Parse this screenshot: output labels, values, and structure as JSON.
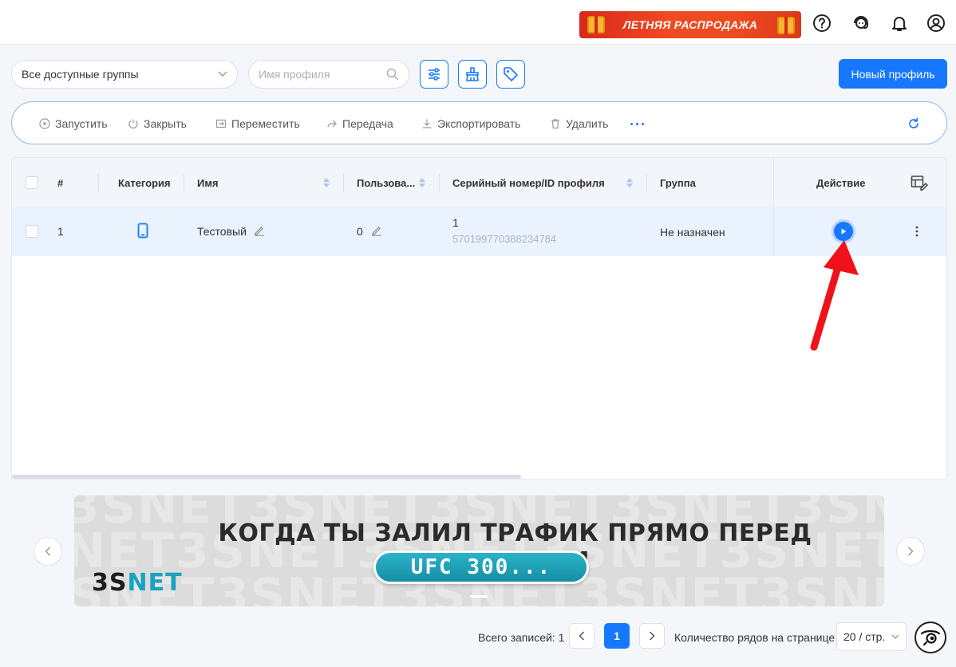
{
  "header": {
    "promo_label": "ЛЕТНЯЯ РАСПРОДАЖА",
    "icons": [
      "help-icon",
      "support-agent-icon",
      "bell-icon",
      "user-account-icon"
    ]
  },
  "filters": {
    "group_select_value": "Все доступные группы",
    "search_placeholder": "Имя профиля",
    "tool_buttons": [
      "filter-sliders-icon",
      "cleanup-broom-icon",
      "tag-icon"
    ],
    "new_profile_label": "Новый профиль"
  },
  "actions": {
    "start": "Запустить",
    "close": "Закрыть",
    "move": "Переместить",
    "transfer": "Передача",
    "export": "Экспортировать",
    "delete": "Удалить",
    "more": "···"
  },
  "table": {
    "headers": {
      "index": "#",
      "category": "Категория",
      "name": "Имя",
      "users": "Пользова...",
      "serial": "Серийный номер/ID профиля",
      "group": "Группа",
      "action": "Действие"
    },
    "rows": [
      {
        "index": "1",
        "category_icon": "phone-icon",
        "name": "Тестовый",
        "users": "0",
        "serial": "1",
        "profile_id": "570199770388234784",
        "group": "Не назначен"
      }
    ]
  },
  "banner": {
    "title": "КОГДА ТЫ ЗАЛИЛ ТРАФИК ПРЯМО ПЕРЕД ФИНАЛОМ",
    "pill": "UFC 300...",
    "logo_part1": "3S",
    "logo_part2": "NET",
    "background_text": "3SNET3SNET3SNET3SNET3SNET"
  },
  "pagination": {
    "total_label": "Всего записей: 1",
    "current_page": "1",
    "rows_label": "Количество рядов на странице",
    "page_size": "20 / стр."
  },
  "colors": {
    "accent": "#1677ff",
    "row_highlight": "#eaf2fe",
    "annotation_arrow": "#f0121b"
  }
}
